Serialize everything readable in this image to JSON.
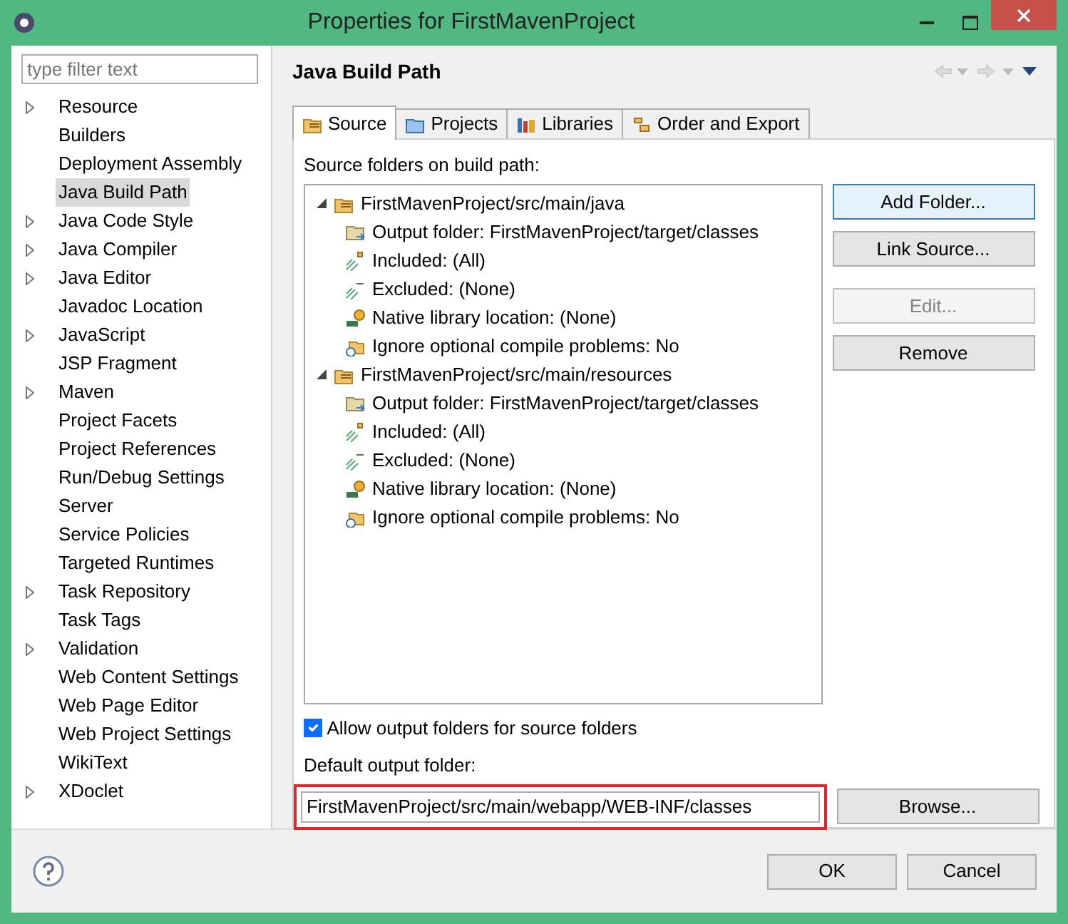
{
  "window": {
    "title": "Properties for FirstMavenProject"
  },
  "filter": {
    "placeholder": "type filter text"
  },
  "sidebar": {
    "items": [
      {
        "label": "Resource",
        "expandable": true,
        "selected": false
      },
      {
        "label": "Builders",
        "expandable": false,
        "selected": false
      },
      {
        "label": "Deployment Assembly",
        "expandable": false,
        "selected": false
      },
      {
        "label": "Java Build Path",
        "expandable": false,
        "selected": true
      },
      {
        "label": "Java Code Style",
        "expandable": true,
        "selected": false
      },
      {
        "label": "Java Compiler",
        "expandable": true,
        "selected": false
      },
      {
        "label": "Java Editor",
        "expandable": true,
        "selected": false
      },
      {
        "label": "Javadoc Location",
        "expandable": false,
        "selected": false
      },
      {
        "label": "JavaScript",
        "expandable": true,
        "selected": false
      },
      {
        "label": "JSP Fragment",
        "expandable": false,
        "selected": false
      },
      {
        "label": "Maven",
        "expandable": true,
        "selected": false
      },
      {
        "label": "Project Facets",
        "expandable": false,
        "selected": false
      },
      {
        "label": "Project References",
        "expandable": false,
        "selected": false
      },
      {
        "label": "Run/Debug Settings",
        "expandable": false,
        "selected": false
      },
      {
        "label": "Server",
        "expandable": false,
        "selected": false
      },
      {
        "label": "Service Policies",
        "expandable": false,
        "selected": false
      },
      {
        "label": "Targeted Runtimes",
        "expandable": false,
        "selected": false
      },
      {
        "label": "Task Repository",
        "expandable": true,
        "selected": false
      },
      {
        "label": "Task Tags",
        "expandable": false,
        "selected": false
      },
      {
        "label": "Validation",
        "expandable": true,
        "selected": false
      },
      {
        "label": "Web Content Settings",
        "expandable": false,
        "selected": false
      },
      {
        "label": "Web Page Editor",
        "expandable": false,
        "selected": false
      },
      {
        "label": "Web Project Settings",
        "expandable": false,
        "selected": false
      },
      {
        "label": "WikiText",
        "expandable": false,
        "selected": false
      },
      {
        "label": "XDoclet",
        "expandable": true,
        "selected": false
      }
    ]
  },
  "page": {
    "title": "Java Build Path"
  },
  "tabs": [
    {
      "label": "Source",
      "kind": "source",
      "selected": true
    },
    {
      "label": "Projects",
      "kind": "projects",
      "selected": false
    },
    {
      "label": "Libraries",
      "kind": "libraries",
      "selected": false
    },
    {
      "label": "Order and Export",
      "kind": "order",
      "selected": false
    }
  ],
  "source_label": "Source folders on build path:",
  "tree": [
    {
      "label": "FirstMavenProject/src/main/java",
      "kind": "folder",
      "expanded": true,
      "children": [
        {
          "label": "Output folder: FirstMavenProject/target/classes",
          "kind": "output"
        },
        {
          "label": "Included: (All)",
          "kind": "included"
        },
        {
          "label": "Excluded: (None)",
          "kind": "excluded"
        },
        {
          "label": "Native library location: (None)",
          "kind": "native"
        },
        {
          "label": "Ignore optional compile problems: No",
          "kind": "ignore"
        }
      ]
    },
    {
      "label": "FirstMavenProject/src/main/resources",
      "kind": "folder",
      "expanded": true,
      "children": [
        {
          "label": "Output folder: FirstMavenProject/target/classes",
          "kind": "output"
        },
        {
          "label": "Included: (All)",
          "kind": "included"
        },
        {
          "label": "Excluded: (None)",
          "kind": "excluded"
        },
        {
          "label": "Native library location: (None)",
          "kind": "native"
        },
        {
          "label": "Ignore optional compile problems: No",
          "kind": "ignore"
        }
      ]
    }
  ],
  "side_buttons": [
    {
      "label": "Add Folder...",
      "disabled": false,
      "default": true
    },
    {
      "label": "Link Source...",
      "disabled": false,
      "default": false
    },
    {
      "label": "Edit...",
      "disabled": true,
      "default": false
    },
    {
      "label": "Remove",
      "disabled": false,
      "default": false
    }
  ],
  "allow_output": {
    "label": "Allow output folders for source folders",
    "checked": true
  },
  "output_folder": {
    "label": "Default output folder:",
    "value": "FirstMavenProject/src/main/webapp/WEB-INF/classes",
    "highlighted": true
  },
  "browse_button": "Browse...",
  "footer_buttons": [
    "OK",
    "Cancel"
  ]
}
